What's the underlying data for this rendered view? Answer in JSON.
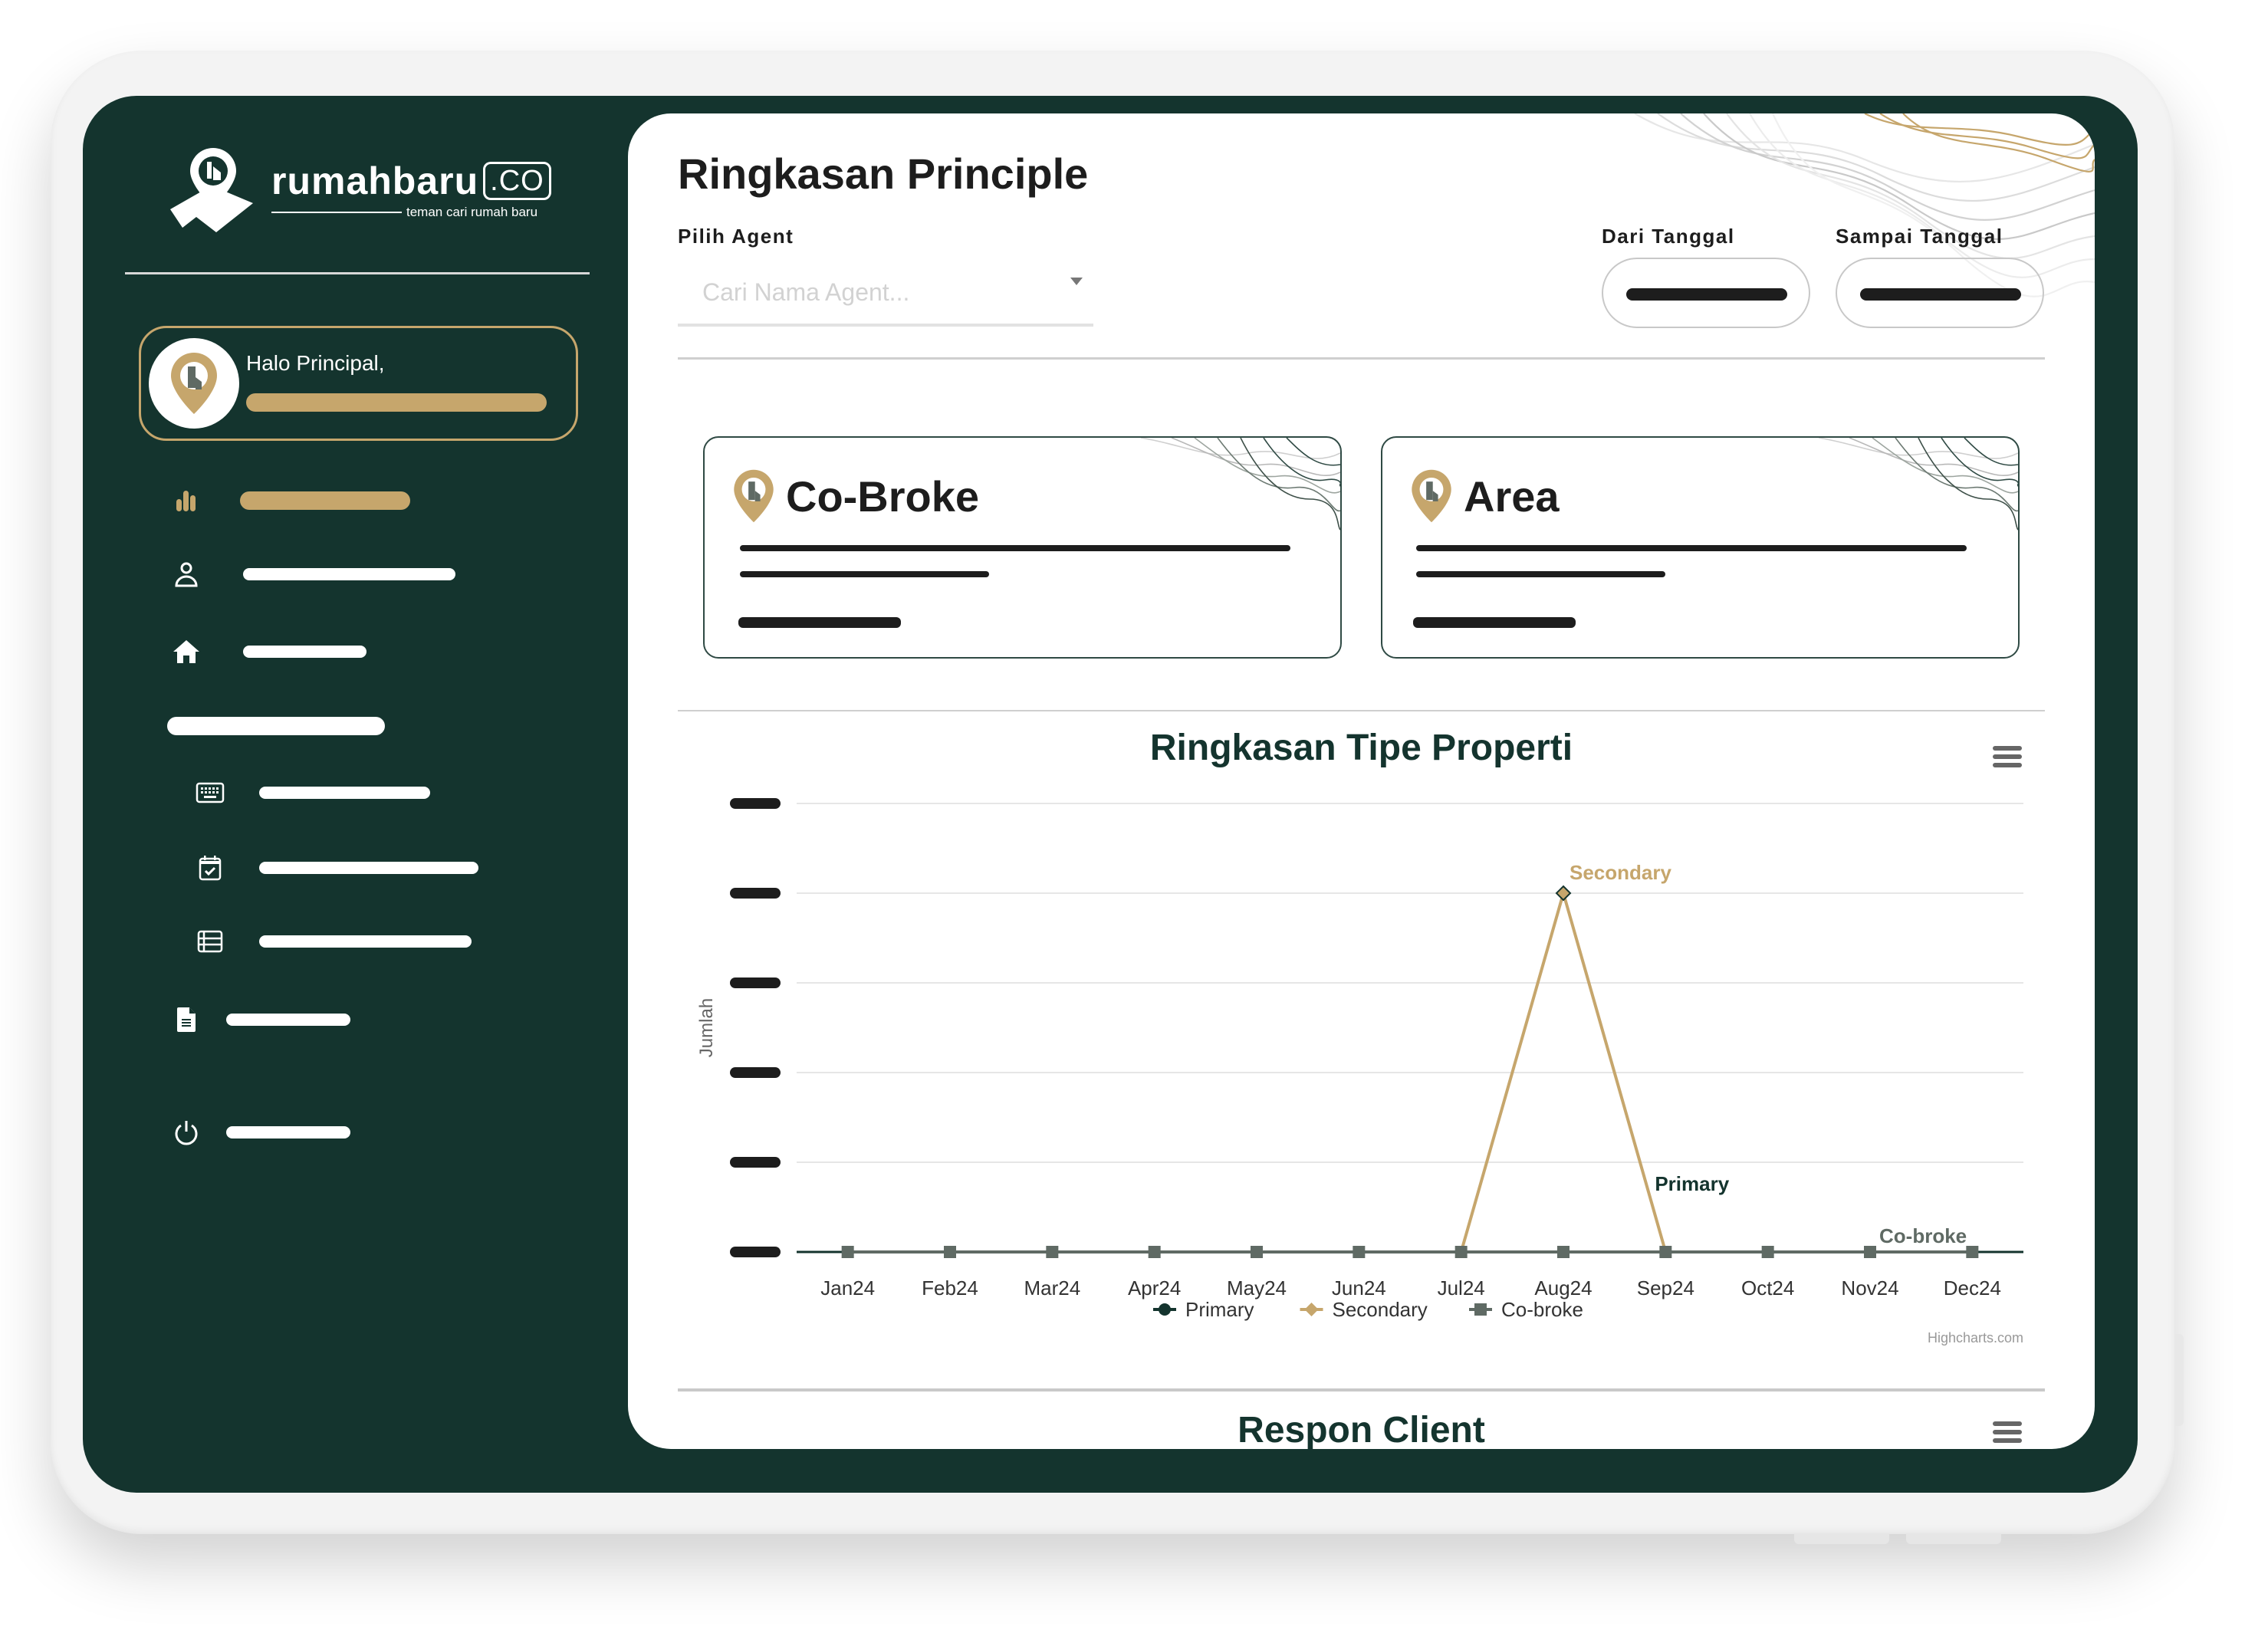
{
  "brand": {
    "name": "rumahbaru",
    "suffix": ".CO",
    "tagline": "teman cari rumah baru"
  },
  "profile": {
    "greeting": "Halo Principal,"
  },
  "sidebar": {
    "items": [
      {
        "icon": "bar-chart-icon",
        "active": true
      },
      {
        "icon": "user-icon",
        "active": false
      },
      {
        "icon": "home-icon",
        "active": false
      },
      {
        "icon": "section-header",
        "active": false
      },
      {
        "icon": "keyboard-icon",
        "active": false
      },
      {
        "icon": "calendar-check-icon",
        "active": false
      },
      {
        "icon": "list-icon",
        "active": false
      },
      {
        "icon": "document-icon",
        "active": false
      },
      {
        "icon": "power-icon",
        "active": false
      }
    ]
  },
  "page": {
    "title": "Ringkasan Principle",
    "agent_label": "Pilih Agent",
    "agent_placeholder": "Cari Nama Agent...",
    "from_label": "Dari Tanggal",
    "to_label": "Sampai Tanggal"
  },
  "cards": [
    {
      "title": "Co-Broke"
    },
    {
      "title": "Area"
    }
  ],
  "colors": {
    "brand_green": "#14342e",
    "gold": "#c6a66c",
    "cobroke_gray": "#5f6a64"
  },
  "chart_data": {
    "type": "line",
    "title": "Ringkasan Tipe Properti",
    "xlabel": "",
    "ylabel": "Jumlah",
    "categories": [
      "Jan24",
      "Feb24",
      "Mar24",
      "Apr24",
      "May24",
      "Jun24",
      "Jul24",
      "Aug24",
      "Sep24",
      "Oct24",
      "Nov24",
      "Dec24"
    ],
    "ylim": [
      0,
      5
    ],
    "grid": true,
    "series": [
      {
        "name": "Primary",
        "color": "#14342e",
        "values": [
          0,
          0,
          0,
          0,
          0,
          0,
          0,
          0,
          0,
          0,
          0,
          0
        ],
        "label_at": 8
      },
      {
        "name": "Secondary",
        "color": "#c6a66c",
        "values": [
          0,
          0,
          0,
          0,
          0,
          0,
          0,
          4,
          0,
          0,
          0,
          0
        ],
        "label_at": 7
      },
      {
        "name": "Co-broke",
        "color": "#5f6a64",
        "values": [
          0,
          0,
          0,
          0,
          0,
          0,
          0,
          0,
          0,
          0,
          0,
          0
        ],
        "label_at": 10
      }
    ],
    "legend": "bottom-center",
    "credits": "Highcharts.com"
  },
  "section2": {
    "title": "Respon Client"
  }
}
